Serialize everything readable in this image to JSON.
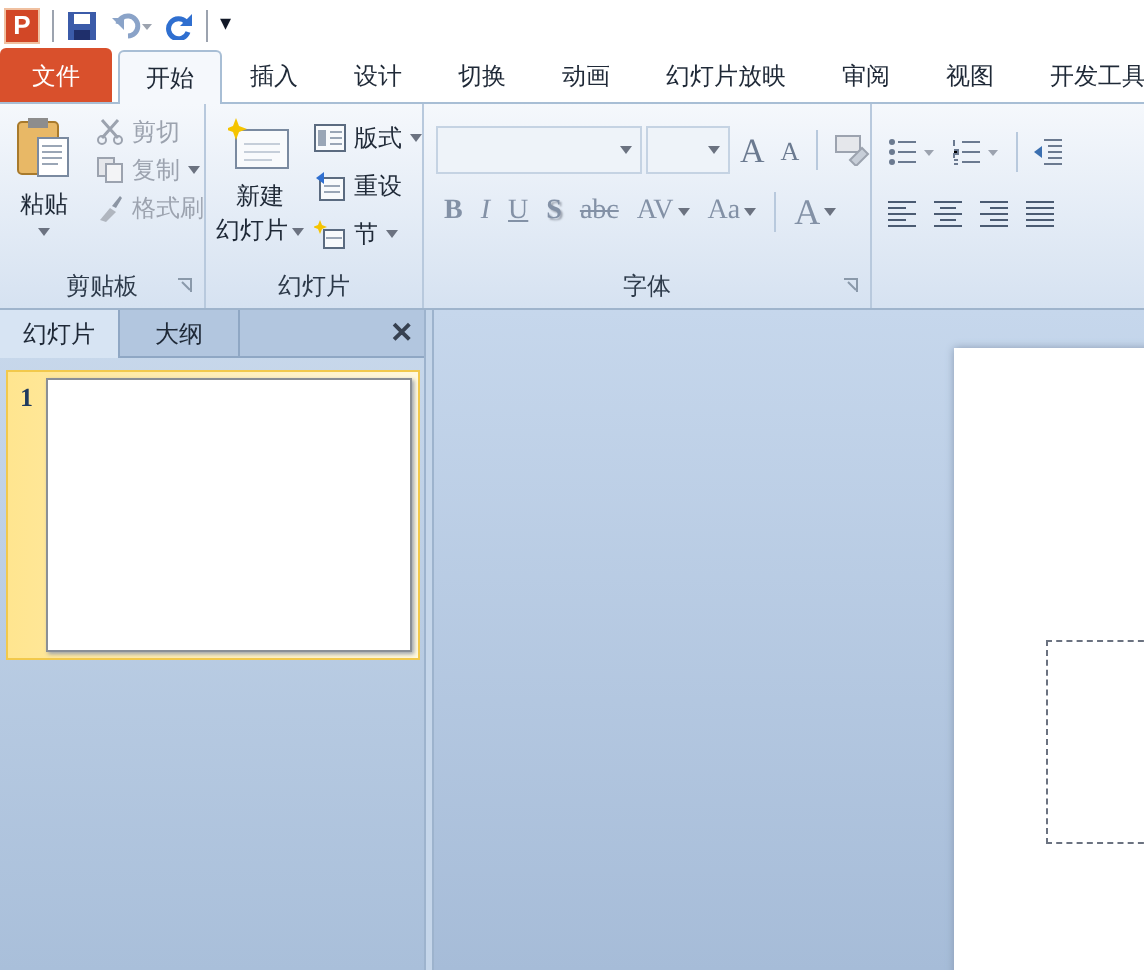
{
  "app_icon": {
    "label": "P"
  },
  "quick_access": {
    "menu_glyph": "▾"
  },
  "tabs": [
    {
      "label": "文件",
      "kind": "file",
      "selected": false
    },
    {
      "label": "开始",
      "kind": "tab",
      "selected": true
    },
    {
      "label": "插入",
      "kind": "tab",
      "selected": false
    },
    {
      "label": "设计",
      "kind": "tab",
      "selected": false
    },
    {
      "label": "切换",
      "kind": "tab",
      "selected": false
    },
    {
      "label": "动画",
      "kind": "tab",
      "selected": false
    },
    {
      "label": "幻灯片放映",
      "kind": "tab",
      "selected": false
    },
    {
      "label": "审阅",
      "kind": "tab",
      "selected": false
    },
    {
      "label": "视图",
      "kind": "tab",
      "selected": false
    },
    {
      "label": "开发工具",
      "kind": "tab",
      "selected": false
    }
  ],
  "clipboard": {
    "title": "剪贴板",
    "paste": "粘贴",
    "items": [
      {
        "label": "剪切",
        "disabled": true
      },
      {
        "label": "复制",
        "disabled": true
      },
      {
        "label": "格式刷",
        "disabled": true
      }
    ]
  },
  "slides_group": {
    "title": "幻灯片",
    "new_slide": [
      "新建",
      "幻灯片"
    ],
    "items": [
      {
        "label": "版式",
        "dropdown": true
      },
      {
        "label": "重设",
        "dropdown": false
      },
      {
        "label": "节",
        "dropdown": true
      }
    ]
  },
  "font": {
    "title": "字体",
    "grow": "A",
    "shrink": "A",
    "buttons": [
      {
        "label": "B",
        "kind": "bold",
        "disabled": true
      },
      {
        "label": "I",
        "kind": "italic",
        "disabled": true
      },
      {
        "label": "U",
        "kind": "underline",
        "disabled": true
      },
      {
        "label": "S",
        "kind": "shadow",
        "disabled": true
      },
      {
        "label": "abc",
        "kind": "strike",
        "disabled": true
      },
      {
        "label": "AV",
        "kind": "spacing",
        "disabled": true
      },
      {
        "label": "Aa",
        "kind": "case",
        "disabled": true
      },
      {
        "label": "A",
        "kind": "color",
        "disabled": true
      }
    ]
  },
  "panel": {
    "tabs": [
      {
        "label": "幻灯片",
        "selected": true
      },
      {
        "label": "大纲",
        "selected": false
      }
    ],
    "close": "✕",
    "slides": [
      {
        "number": "1",
        "selected": true
      }
    ]
  }
}
